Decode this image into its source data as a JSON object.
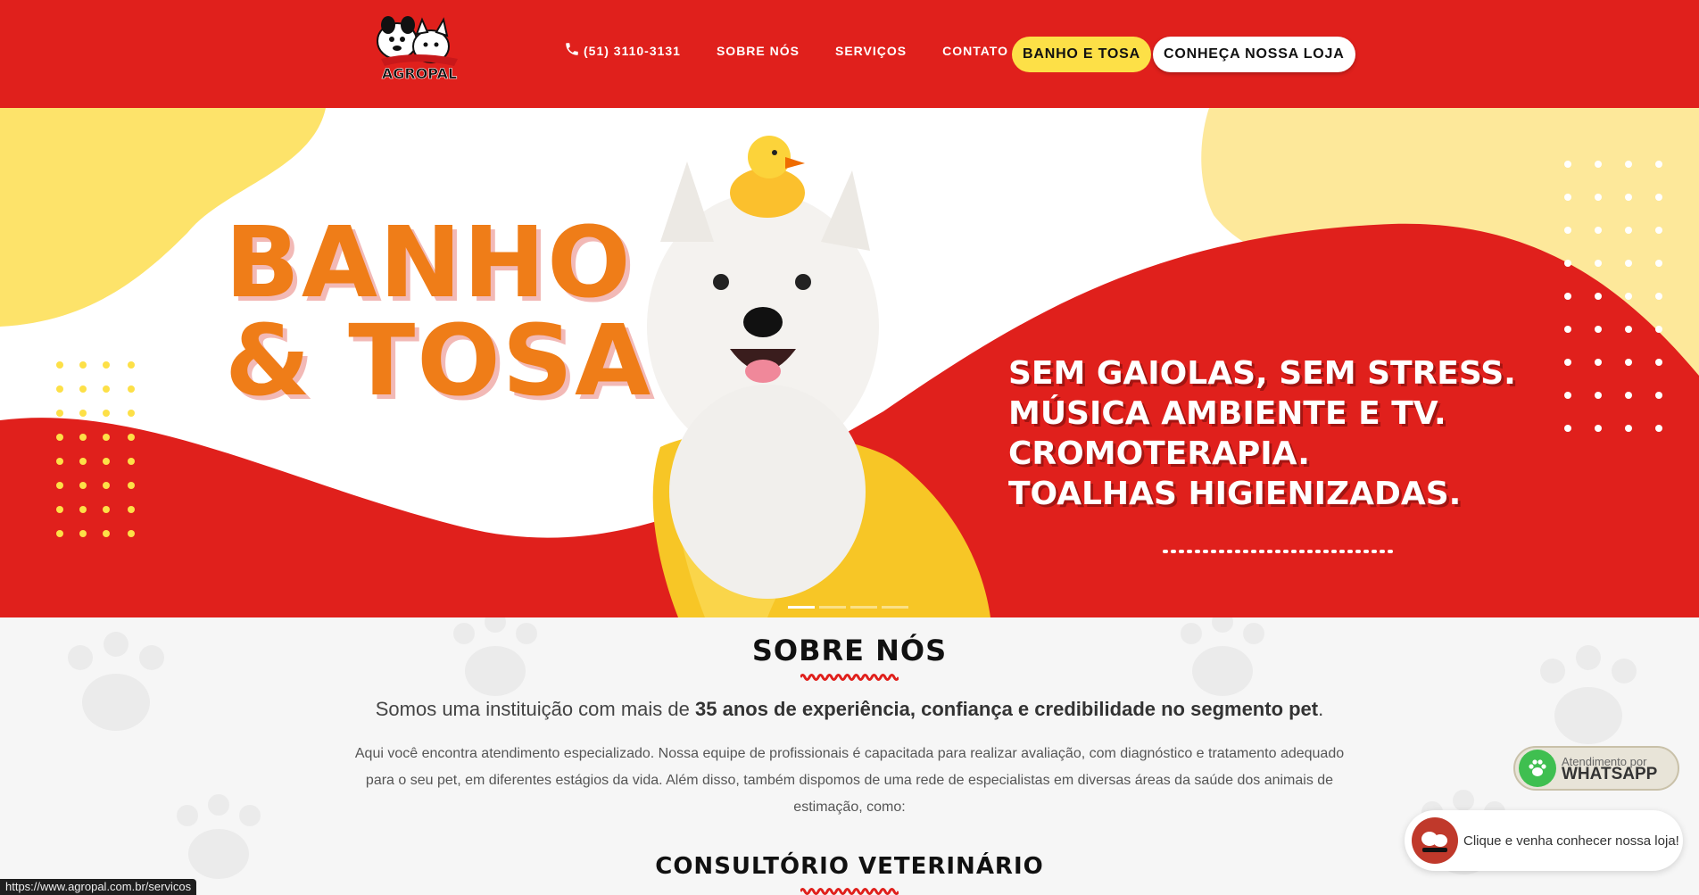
{
  "header": {
    "logo_text": "AGROPAL",
    "phone": "(51) 3110-3131",
    "nav": [
      "SOBRE NÓS",
      "SERVIÇOS",
      "CONTATO"
    ],
    "cta_primary": "BANHO E TOSA",
    "cta_secondary": "CONHEÇA NOSSA LOJA"
  },
  "banner": {
    "title_line1": "BANHO",
    "title_line2": "& TOSA",
    "features": [
      "SEM GAIOLAS, SEM STRESS.",
      "MÚSICA AMBIENTE E TV.",
      "CROMOTERAPIA.",
      "TOALHAS HIGIENIZADAS."
    ],
    "slides": 4,
    "active_slide": 1
  },
  "about": {
    "title": "SOBRE NÓS",
    "lead_prefix": "Somos uma instituição com mais de ",
    "lead_bold": "35 anos de experiência, confiança e credibilidade no segmento pet",
    "lead_suffix": ".",
    "body": "Aqui você encontra atendimento especializado. Nossa equipe de profissionais é capacitada para realizar avaliação, com diagnóstico e tratamento adequado para o seu pet, em diferentes estágios da vida. Além disso, também dispomos de uma rede de especialistas em diversas áreas da saúde dos animais de estimação, como:",
    "subsection_title": "CONSULTÓRIO VETERINÁRIO"
  },
  "whatsapp": {
    "small": "Atendimento por",
    "big": "WHATSAPP",
    "popup_text": "Clique e venha conhecer nossa loja!"
  },
  "status_bar": {
    "url": "https://www.agropal.com.br/servicos"
  },
  "colors": {
    "brand_red": "#e0201c",
    "brand_yellow": "#fde047",
    "banner_orange": "#ef7d18",
    "whatsapp_green": "#3fbf50"
  }
}
